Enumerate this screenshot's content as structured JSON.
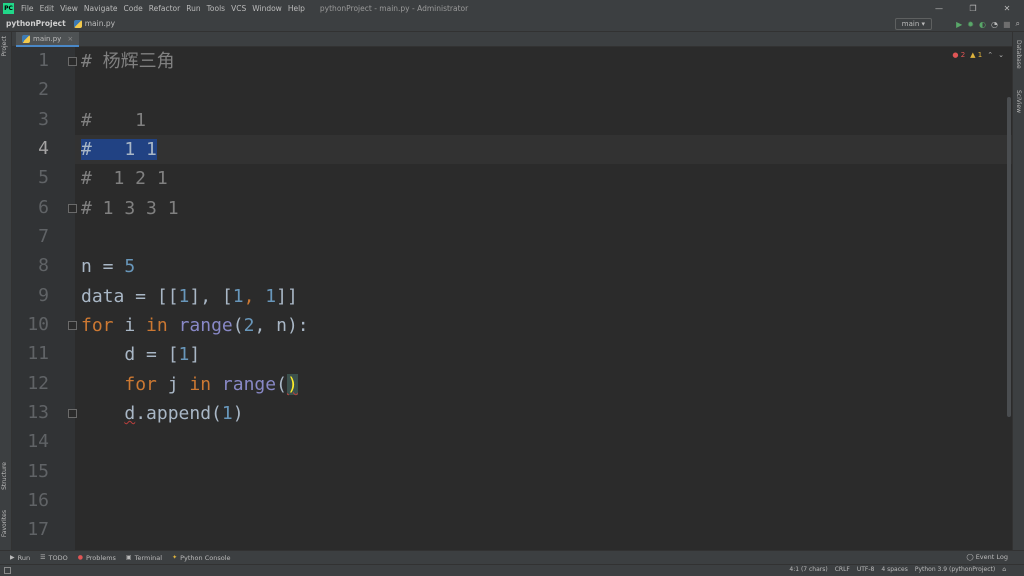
{
  "menu": {
    "items": [
      "File",
      "Edit",
      "View",
      "Navigate",
      "Code",
      "Refactor",
      "Run",
      "Tools",
      "VCS",
      "Window",
      "Help"
    ],
    "window_title": "pythonProject - main.py - Administrator"
  },
  "window_controls": {
    "minimize": "—",
    "restore": "❐",
    "close": "✕"
  },
  "breadcrumb": {
    "project": "pythonProject",
    "file": "main.py"
  },
  "run_config": {
    "label": "main ▾"
  },
  "editor_tab": {
    "label": "main.py",
    "close": "×"
  },
  "side_tabs": {
    "project": "Project",
    "structure": "Structure",
    "favorites": "Favorites",
    "database": "Database",
    "sciview": "SciView"
  },
  "inspections": {
    "errors": "2",
    "warnings": "1"
  },
  "line_numbers": [
    "1",
    "2",
    "3",
    "4",
    "5",
    "6",
    "7",
    "8",
    "9",
    "10",
    "11",
    "12",
    "13",
    "14",
    "15",
    "16",
    "17"
  ],
  "code": {
    "l1": "# 杨辉三角",
    "l3": "#    1",
    "l4": "#   1 1",
    "l5": "#  1 2 1",
    "l6": "# 1 3 3 1",
    "l8_var": "n = ",
    "l8_num": "5",
    "l9_a": "data = [[",
    "l9_b": "1",
    "l9_c": "], [",
    "l9_d": "1",
    "l9_e": ", ",
    "l9_f": "1",
    "l9_g": "]]",
    "l10_for": "for",
    "l10_i": " i ",
    "l10_in": "in",
    "l10_sp": " ",
    "l10_range": "range",
    "l10_open": "(",
    "l10_num": "2",
    "l10_rest": ", n):",
    "l11_a": "    d = [",
    "l11_num": "1",
    "l11_b": "]",
    "l12_ind": "    ",
    "l12_for": "for",
    "l12_j": " j ",
    "l12_in": "in",
    "l12_sp": " ",
    "l12_range": "range",
    "l12_open": "(",
    "l12_close": ")",
    "l13_ind": "    ",
    "l13_d": "d",
    "l13_a": ".append(",
    "l13_num": "1",
    "l13_b": ")"
  },
  "bottom_tools": [
    {
      "icon": "▶",
      "label": "Run"
    },
    {
      "icon": "☰",
      "label": "TODO"
    },
    {
      "icon": "●",
      "label": "Problems"
    },
    {
      "icon": "▣",
      "label": "Terminal"
    },
    {
      "icon": "✦",
      "label": "Python Console"
    }
  ],
  "event_log": "Event Log",
  "status": {
    "position": "4:1 (7 chars)",
    "line_sep": "CRLF",
    "encoding": "UTF-8",
    "indent": "4 spaces",
    "interpreter": "Python 3.9 (pythonProject)"
  },
  "colors": {
    "background": "#2b2b2b",
    "keyword": "#cc7832",
    "number": "#6897bb",
    "builtin": "#8888c6",
    "comment": "#808080",
    "selection": "#214283"
  }
}
